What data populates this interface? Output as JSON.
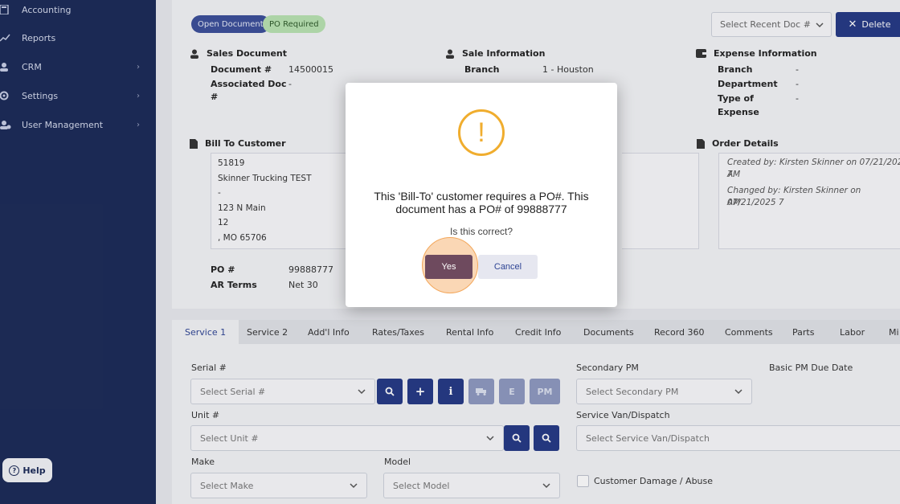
{
  "sidebar": {
    "items": [
      {
        "label": "Accounting",
        "icon": "calculator-icon"
      },
      {
        "label": "Reports",
        "icon": "chart-icon"
      },
      {
        "label": "CRM",
        "icon": "users-icon"
      },
      {
        "label": "Settings",
        "icon": "gear-icon"
      },
      {
        "label": "User Management",
        "icon": "user-gear-icon"
      }
    ],
    "help_label": "Help"
  },
  "header": {
    "badges": [
      "Open Document",
      "PO Required"
    ],
    "recent_doc_placeholder": "Select Recent Doc #",
    "delete_label": "Delete"
  },
  "sales_document": {
    "title": "Sales Document",
    "doc_label": "Document #",
    "doc_value": "14500015",
    "assoc_label_1": "Associated Doc",
    "assoc_label_2": "#",
    "assoc_value": "-"
  },
  "sale_information": {
    "title": "Sale Information",
    "branch_label": "Branch",
    "branch_value": "1 - Houston"
  },
  "expense_information": {
    "title": "Expense Information",
    "branch_label": "Branch",
    "branch_value": "-",
    "department_label": "Department",
    "department_value": "-",
    "type_label_1": "Type of",
    "type_label_2": "Expense",
    "type_value": "-"
  },
  "bill_to": {
    "title": "Bill To Customer",
    "lines": [
      "51819",
      "Skinner Trucking TEST",
      "-",
      "123 N Main",
      "12",
      ", MO 65706"
    ],
    "po_label": "PO #",
    "po_value": "99888777",
    "terms_label": "AR Terms",
    "terms_value": "Net 30"
  },
  "order_details": {
    "title": "Order Details",
    "created_1": "Created by: Kirsten Skinner on 07/21/2025 7:",
    "created_2": "AM",
    "changed_1": "Changed by: Kirsten Skinner on 07/21/2025 7",
    "changed_2": "AM"
  },
  "tabs": [
    "Service 1",
    "Service 2",
    "Add'l Info",
    "Rates/Taxes",
    "Rental Info",
    "Credit Info",
    "Documents",
    "Record 360",
    "Comments",
    "Parts",
    "Labor",
    "Mi"
  ],
  "form": {
    "serial_label": "Serial #",
    "serial_placeholder": "Select Serial #",
    "unit_label": "Unit #",
    "unit_placeholder": "Select Unit #",
    "make_label": "Make",
    "make_placeholder": "Select Make",
    "model_label": "Model",
    "model_placeholder": "Select Model",
    "secondary_pm_label": "Secondary PM",
    "secondary_pm_placeholder": "Select Secondary PM",
    "basic_pm_label": "Basic PM Due Date",
    "van_label": "Service Van/Dispatch",
    "van_placeholder": "Select Service Van/Dispatch",
    "damage_label": "Customer Damage / Abuse",
    "btn_e": "E",
    "btn_pm": "PM"
  },
  "modal": {
    "icon": "warning-icon",
    "message": "This 'Bill-To' customer requires a PO#. This document has a PO# of 99888777",
    "question": "Is this correct?",
    "yes_label": "Yes",
    "cancel_label": "Cancel"
  }
}
